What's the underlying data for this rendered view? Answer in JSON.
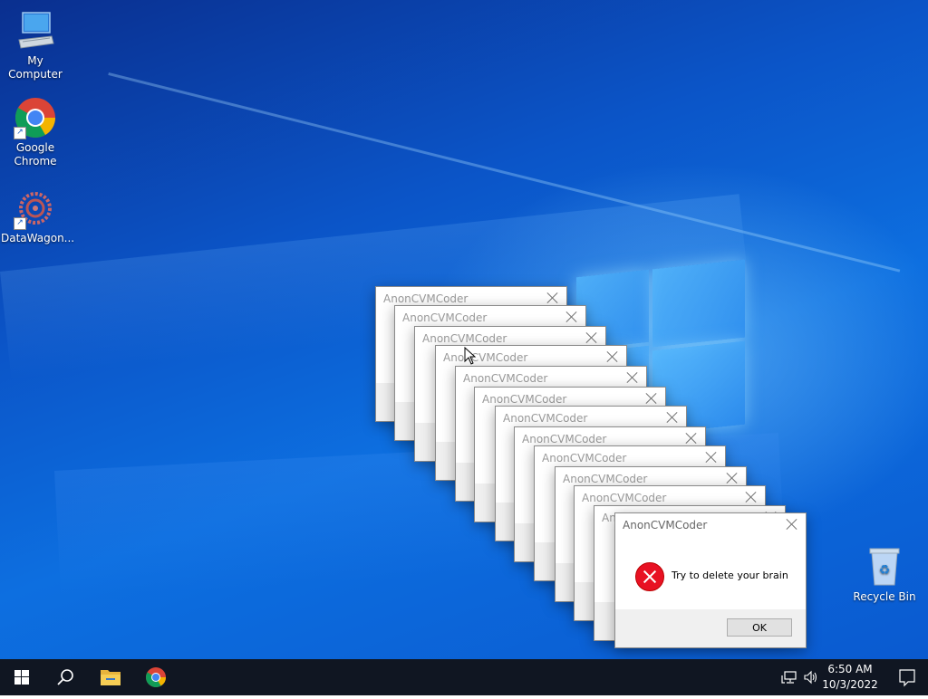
{
  "desktop": {
    "icons": [
      {
        "label": "My Computer",
        "icon": "computer-icon"
      },
      {
        "label": "Google\nChrome",
        "icon": "chrome-icon"
      },
      {
        "label": "DataWagon...",
        "icon": "datawagon-icon"
      },
      {
        "label": "Recycle Bin",
        "icon": "recycle-bin-icon"
      }
    ]
  },
  "dialogs": {
    "title": "AnonCVMCoder",
    "message": "Try to delete your brain",
    "ok_label": "OK"
  },
  "taskbar": {
    "time": "6:50 AM",
    "date": "10/3/2022"
  },
  "colors": {
    "error": "#e81123",
    "taskbar": "#101622"
  }
}
